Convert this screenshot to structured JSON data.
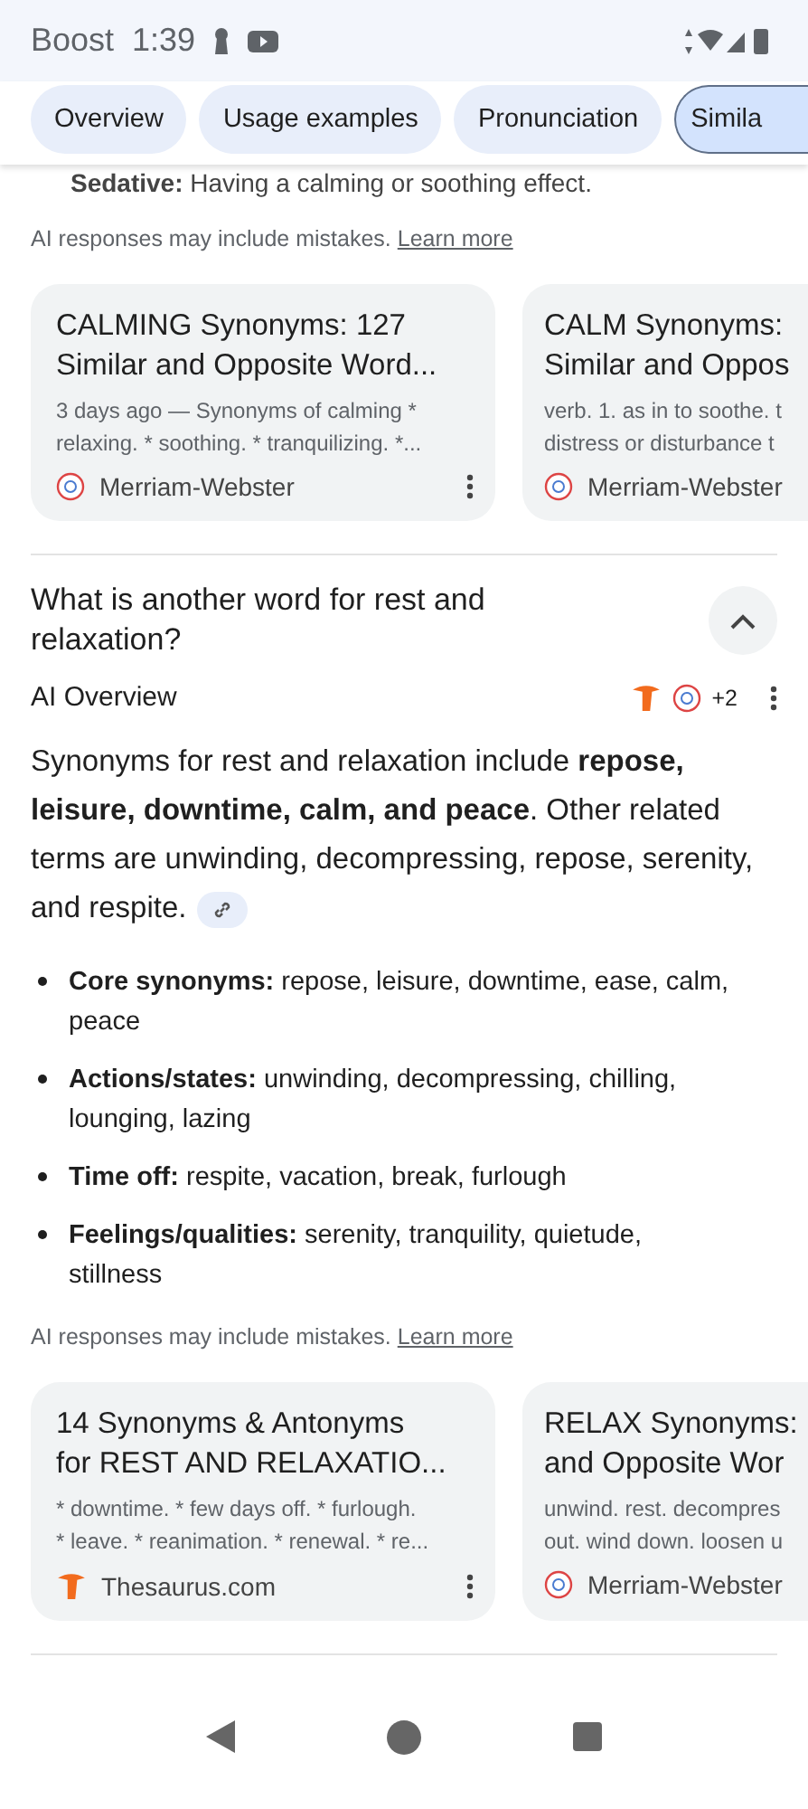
{
  "status_bar": {
    "carrier": "Boost",
    "time": "1:39"
  },
  "chips": [
    {
      "label": "Overview",
      "selected": false
    },
    {
      "label": "Usage examples",
      "selected": false
    },
    {
      "label": "Pronunciation",
      "selected": false
    },
    {
      "label": "Simila",
      "selected": true
    }
  ],
  "cut_line": {
    "term": "Sedative:",
    "text": "Having a calming or soothing effect."
  },
  "disclaimer_1": {
    "text": "AI responses may include mistakes.",
    "link": "Learn more"
  },
  "cards_1": [
    {
      "kind": "mw",
      "title": "CALMING Synonyms: 127\nSimilar and Opposite Word...",
      "snippet": "3 days ago — Synonyms of calming *\nrelaxing. * soothing. * tranquilizing. *...",
      "source": "Merriam-Webster"
    },
    {
      "kind": "mw",
      "title": "CALM Synonyms:\nSimilar and Oppos",
      "snippet": "verb. 1. as in to soothe. t\ndistress or disturbance t",
      "source": "Merriam-Webster"
    }
  ],
  "question": {
    "text": "What is another word for rest and relaxation?",
    "expanded": true
  },
  "ai_overview": {
    "label": "AI Overview",
    "source_count": "+2",
    "summary": "Synonyms for rest and relaxation include **repose, leisure, downtime, calm, and peace**. Other related terms are unwinding, decompressing, repose, serenity, and respite.",
    "bullets": [
      {
        "term": "Core synonyms:",
        "text": "repose, leisure, downtime, ease, calm, peace"
      },
      {
        "term": "Actions/states:",
        "text": "unwinding, decompressing, chilling, lounging, lazing"
      },
      {
        "term": "Time off:",
        "text": "respite, vacation, break, furlough"
      },
      {
        "term": "Feelings/qualities:",
        "text": "serenity, tranquility, quietude, stillness"
      }
    ]
  },
  "disclaimer_2": {
    "text": "AI responses may include mistakes.",
    "link": "Learn more"
  },
  "cards_2": [
    {
      "kind": "thesaurus",
      "title": "14 Synonyms & Antonyms\nfor REST AND RELAXATIO...",
      "snippet": "* downtime. * few days off. * furlough.\n* leave. * reanimation. * renewal. * re...",
      "source": "Thesaurus.com"
    },
    {
      "kind": "mw",
      "title": "RELAX Synonyms:\nand Opposite Wor",
      "snippet": "unwind. rest. decompres\nout. wind down. loosen u",
      "source": "Merriam-Webster"
    }
  ]
}
